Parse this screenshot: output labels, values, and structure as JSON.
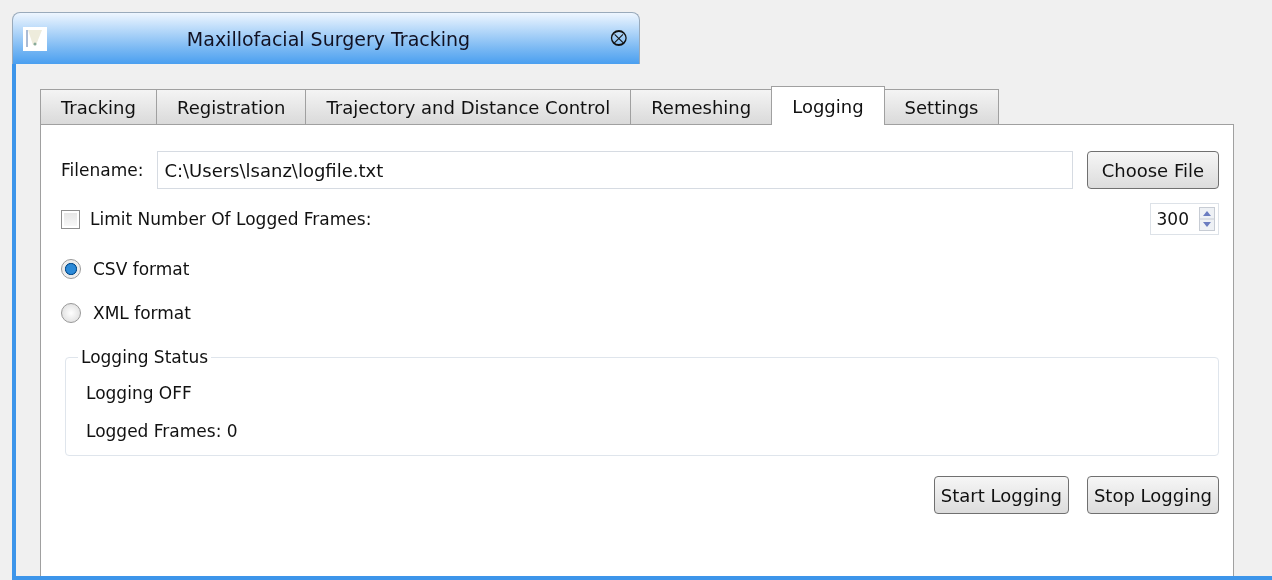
{
  "window": {
    "title": "Maxillofacial Surgery Tracking",
    "close_glyph": "⮾"
  },
  "tabs": [
    {
      "label": "Tracking",
      "selected": false
    },
    {
      "label": "Registration",
      "selected": false
    },
    {
      "label": "Trajectory and Distance Control",
      "selected": false
    },
    {
      "label": "Remeshing",
      "selected": false
    },
    {
      "label": "Logging",
      "selected": true
    },
    {
      "label": "Settings",
      "selected": false
    }
  ],
  "filename": {
    "label": "Filename:",
    "value": "C:\\Users\\lsanz\\logfile.txt",
    "button": "Choose File"
  },
  "limit": {
    "label": "Limit Number Of Logged Frames:",
    "checked": false,
    "value": "300"
  },
  "formats": [
    {
      "label": "CSV format",
      "selected": true
    },
    {
      "label": "XML format",
      "selected": false
    }
  ],
  "status": {
    "title": "Logging Status",
    "lines": [
      "Logging OFF",
      "Logged Frames: 0"
    ]
  },
  "buttons": [
    "Start Logging",
    "Stop Logging"
  ]
}
